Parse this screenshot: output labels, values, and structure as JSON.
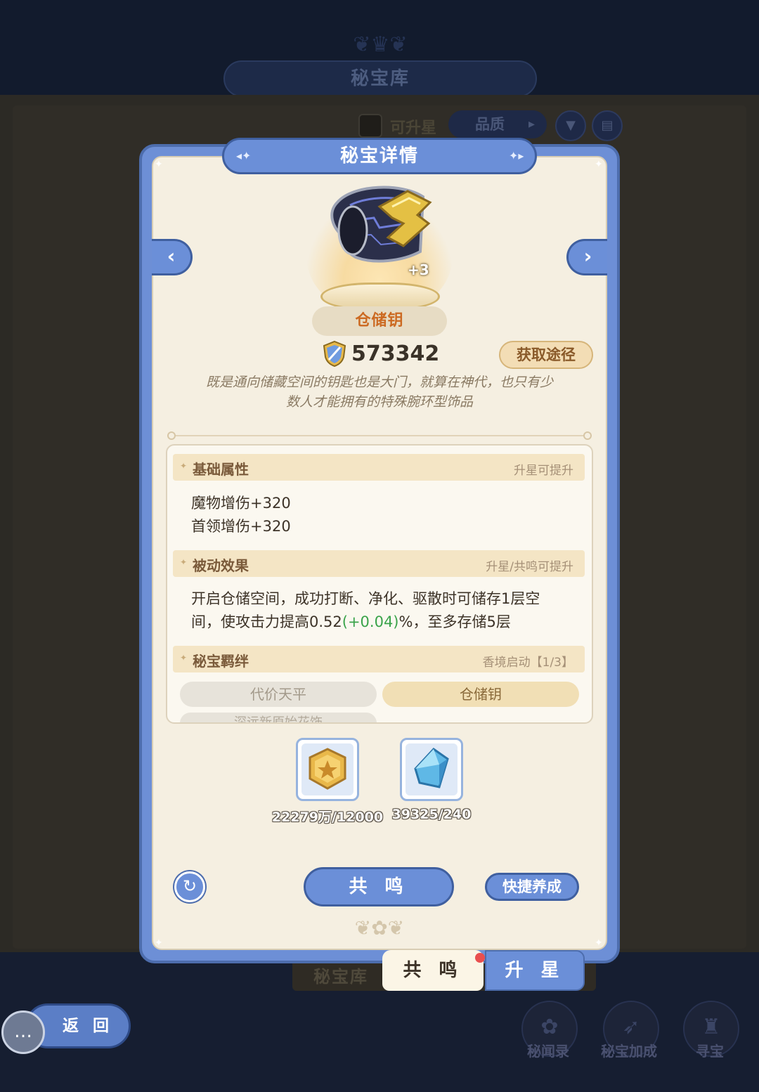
{
  "background": {
    "vault_title": "秘宝库",
    "filter_upgradable_label": "可升星",
    "sort_quality_label": "品质",
    "bottom_nav": {
      "vault_tab": "秘宝库"
    },
    "corner_buttons": [
      {
        "label": "秘闻录",
        "icon": "scroll-icon"
      },
      {
        "label": "秘宝加成",
        "icon": "arrow-up-icon"
      },
      {
        "label": "寻宝",
        "icon": "treasure-bag-icon"
      }
    ]
  },
  "modal": {
    "title": "秘宝详情",
    "item": {
      "name": "仓储钥",
      "star_level": "+3",
      "power": "573342",
      "obtain_label": "获取途径",
      "description_lines": [
        "既是通向储藏空间的钥匙也是大门，就算在神代，也只有少",
        "数人才能拥有的特殊腕环型饰品"
      ]
    },
    "sections": {
      "basic": {
        "title": "基础属性",
        "note": "升星可提升",
        "lines": [
          "魔物增伤+320",
          "首领增伤+320"
        ]
      },
      "passive": {
        "title": "被动效果",
        "note": "升星/共鸣可提升",
        "line1": "开启仓储空间，成功打断、净化、驱散时可储存1层空",
        "line2_prefix": "间，使攻击力提高0.52",
        "line2_bonus": "(+0.04)",
        "line2_suffix": "%，至多存储5层"
      },
      "bond": {
        "title": "秘宝羁绊",
        "note": "香境启动【1/3】",
        "items": [
          "代价天平",
          "仓储钥",
          "深远新原始花饰"
        ]
      }
    },
    "materials": [
      {
        "icon": "gold-medal-icon",
        "count": "22279万/12000"
      },
      {
        "icon": "blue-crystal-icon",
        "count": "39325/240"
      }
    ],
    "resonate_button": "共 鸣",
    "quick_button": "快捷养成"
  },
  "tabs": {
    "resonate": "共 鸣",
    "star_up": "升 星"
  },
  "back_button": "返 回",
  "colors": {
    "modal_blue": "#6b8fd8",
    "parchment": "#f5efe1",
    "bonus_green": "#3aa34a",
    "item_name_orange": "#cc6a22",
    "notification_red": "#e94f4f"
  }
}
